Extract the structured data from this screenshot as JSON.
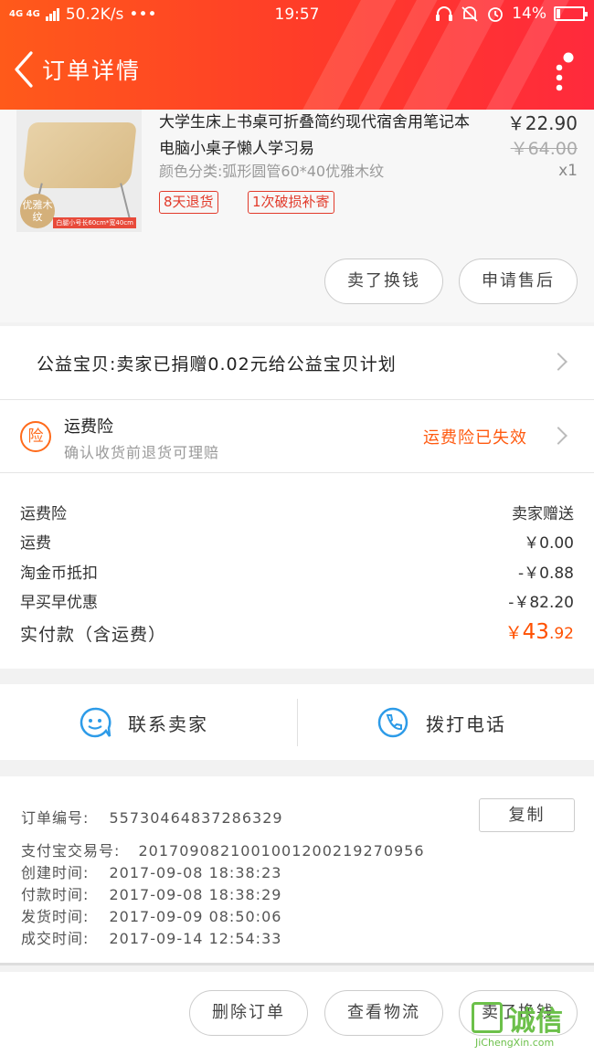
{
  "status_bar": {
    "network": "4G 4G",
    "speed": "50.2K/s",
    "dots": "•••",
    "time": "19:57",
    "battery": "14%"
  },
  "header": {
    "title": "订单详情"
  },
  "product": {
    "title": "大学生床上书桌可折叠简约现代宿舍用笔记本电脑小桌子懒人学习易",
    "spec": "颜色分类:弧形圆管60*40优雅木纹",
    "price": "￥22.90",
    "original_price": "￥64.00",
    "quantity": "x1",
    "image_badge": "优雅木纹",
    "image_caption": "白腿小号长60cm*宽40cm",
    "tags": [
      "8天退货",
      "1次破损补寄"
    ],
    "buttons": {
      "sell": "卖了换钱",
      "after_sale": "申请售后"
    }
  },
  "charity": {
    "text": "公益宝贝:卖家已捐赠0.02元给公益宝贝计划"
  },
  "insurance": {
    "icon_text": "险",
    "title": "运费险",
    "subtitle": "确认收货前退货可理赔",
    "status": "运费险已失效"
  },
  "fees": [
    {
      "label": "运费险",
      "value": "卖家赠送"
    },
    {
      "label": "运费",
      "value": "￥0.00"
    },
    {
      "label": "淘金币抵扣",
      "value": "-￥0.88"
    },
    {
      "label": "早买早优惠",
      "value": "-￥82.20"
    }
  ],
  "total": {
    "label": "实付款（含运费）",
    "currency": "￥",
    "integer": "43",
    "decimal": ".92"
  },
  "contact": {
    "seller": "联系卖家",
    "phone": "拨打电话"
  },
  "order_info": {
    "order_no_label": "订单编号:",
    "order_no": "55730464837286329",
    "copy_button": "复制",
    "lines": [
      {
        "label": "支付宝交易号:",
        "value": "2017090821001001200219270956"
      },
      {
        "label": "创建时间:",
        "value": "2017-09-08 18:38:23"
      },
      {
        "label": "付款时间:",
        "value": "2017-09-08 18:38:29"
      },
      {
        "label": "发货时间:",
        "value": "2017-09-09 08:50:06"
      },
      {
        "label": "成交时间:",
        "value": "2017-09-14 12:54:33"
      }
    ]
  },
  "bottom_actions": {
    "delete": "删除订单",
    "logistics": "查看物流",
    "sell": "卖了换钱"
  },
  "watermark": {
    "brand": "诚信",
    "url": "JiChengXin.com"
  },
  "colors": {
    "brand": "#ff4a24",
    "accent": "#ff5000",
    "tag": "#e23a2a"
  }
}
